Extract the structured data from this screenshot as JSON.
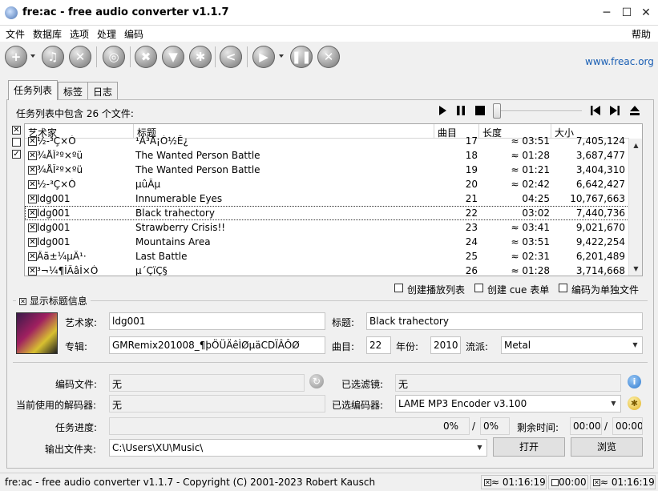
{
  "window": {
    "title": "fre:ac - free audio converter v1.1.7",
    "minimize": "─",
    "maximize": "☐",
    "close": "✕"
  },
  "menu": {
    "left": [
      "文件",
      "数据库",
      "选项",
      "处理",
      "编码"
    ],
    "help": "帮助"
  },
  "toolbar": {
    "website": "www.freac.org"
  },
  "tabs": [
    "任务列表",
    "标签",
    "日志"
  ],
  "joblist": {
    "info": "任务列表中包含 26 个文件:",
    "headers": {
      "artist": "艺术家",
      "title": "标题",
      "track": "曲目",
      "length": "长度",
      "size": "大小"
    },
    "rows": [
      {
        "artist": "½-³Ç×Ó",
        "title": "¹Ä³Å¡Ó½Ê¿",
        "track": "17",
        "length": "≈ 03:51",
        "size": "7,405,124",
        "checked": "☒"
      },
      {
        "artist": "¾ÅÎ²º×ºü",
        "title": "The Wanted Person Battle",
        "track": "18",
        "length": "≈ 01:28",
        "size": "3,687,477",
        "checked": "☒"
      },
      {
        "artist": "¾ÅÎ²º×ºü",
        "title": "The Wanted Person Battle",
        "track": "19",
        "length": "≈ 01:21",
        "size": "3,404,310",
        "checked": "☒"
      },
      {
        "artist": "½-³Ç×Ó",
        "title": "µûÂµ",
        "track": "20",
        "length": "≈ 02:42",
        "size": "6,642,427",
        "checked": "☒"
      },
      {
        "artist": "ldg001",
        "title": "Innumerable Eyes",
        "track": "21",
        "length": "04:25",
        "size": "10,767,663",
        "checked": "☒"
      },
      {
        "artist": "ldg001",
        "title": "Black trahectory",
        "track": "22",
        "length": "03:02",
        "size": "7,440,736",
        "checked": "☒"
      },
      {
        "artist": "ldg001",
        "title": "Strawberry Crisis!!",
        "track": "23",
        "length": "≈ 03:41",
        "size": "9,021,670",
        "checked": "☒"
      },
      {
        "artist": "ldg001",
        "title": "Mountains Area",
        "track": "24",
        "length": "≈ 03:51",
        "size": "9,422,254",
        "checked": "☒"
      },
      {
        "artist": "Âã±¼µÄ¹·",
        "title": "Last Battle",
        "track": "25",
        "length": "≈ 02:31",
        "size": "6,201,489",
        "checked": "☒"
      },
      {
        "artist": "³¬¼¶ÍÃâÌ×Ó",
        "title": "µ´ÇïÇ§",
        "track": "26",
        "length": "≈ 01:28",
        "size": "3,714,668",
        "checked": "☒"
      }
    ],
    "selected_track": "22"
  },
  "options": {
    "playlist": "创建播放列表",
    "cuesheet": "创建 cue 表单",
    "single_file": "编码为单独文件"
  },
  "titleinfo": {
    "toggle": "显示标题信息",
    "artist_label": "艺术家:",
    "artist": "ldg001",
    "title_label": "标题:",
    "title": "Black trahectory",
    "album_label": "专辑:",
    "album": "GMRemix201008_¶þÖÜÄêÌØµäCDÏÂÔØ",
    "track_label": "曲目:",
    "track": "22",
    "year_label": "年份:",
    "year": "2010",
    "genre_label": "流派:",
    "genre": "Metal"
  },
  "encoding": {
    "file_label": "编码文件:",
    "file": "无",
    "filters_label": "已选滤镜:",
    "filters": "无",
    "decoder_label": "当前使用的解码器:",
    "decoder": "无",
    "encoder_label": "已选编码器:",
    "encoder": "LAME MP3 Encoder v3.100",
    "progress_label": "任务进度:",
    "progress_pct": "0%",
    "slash": "/",
    "total_pct": "0%",
    "remaining_label": "剩余时间:",
    "remaining": "00:00",
    "total_time": "00:00",
    "output_label": "输出文件夹:",
    "output": "C:\\Users\\XU\\Music\\",
    "open_button": "打开",
    "browse_button": "浏览"
  },
  "statusbar": {
    "copyright": "fre:ac - free audio converter v1.1.7 - Copyright (C) 2001-2023 Robert Kausch",
    "sel_time": "≈ 01:16:19",
    "unsel_time": "00:00",
    "all_time": "≈ 01:16:19"
  },
  "colors": {
    "accent": "#1a5fb4"
  }
}
